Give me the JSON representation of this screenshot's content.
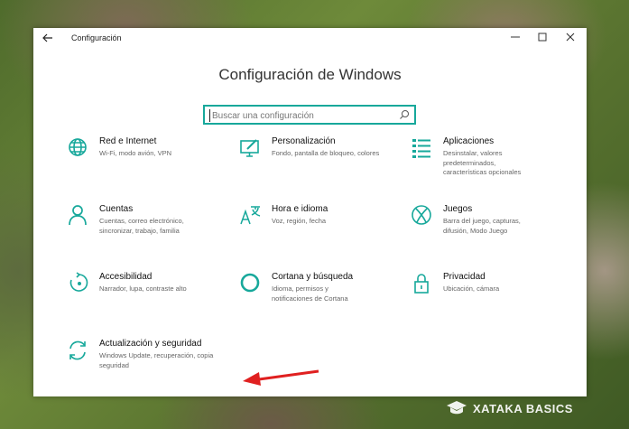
{
  "window": {
    "title": "Configuración",
    "heading": "Configuración de Windows",
    "controls": [
      "minimize-icon",
      "maximize-icon",
      "close-icon"
    ]
  },
  "search": {
    "placeholder": "Buscar una configuración",
    "value": ""
  },
  "tiles": [
    {
      "title": "Red e Internet",
      "desc": "Wi-Fi, modo avión, VPN",
      "icon": "globe-icon"
    },
    {
      "title": "Personalización",
      "desc": "Fondo, pantalla de bloqueo, colores",
      "icon": "personalization-icon"
    },
    {
      "title": "Aplicaciones",
      "desc": "Desinstalar, valores predeterminados, características opcionales",
      "icon": "apps-list-icon"
    },
    {
      "title": "Cuentas",
      "desc": "Cuentas, correo electrónico, sincronizar, trabajo, familia",
      "icon": "person-icon"
    },
    {
      "title": "Hora e idioma",
      "desc": "Voz, región, fecha",
      "icon": "time-language-icon"
    },
    {
      "title": "Juegos",
      "desc": "Barra del juego, capturas, difusión, Modo Juego",
      "icon": "xbox-icon"
    },
    {
      "title": "Accesibilidad",
      "desc": "Narrador, lupa, contraste alto",
      "icon": "accessibility-icon"
    },
    {
      "title": "Cortana y búsqueda",
      "desc": "Idioma, permisos y notificaciones de Cortana",
      "icon": "cortana-icon"
    },
    {
      "title": "Privacidad",
      "desc": "Ubicación, cámara",
      "icon": "lock-icon"
    },
    {
      "title": "Actualización y seguridad",
      "desc": "Windows Update, recuperación, copia seguridad",
      "icon": "update-icon"
    }
  ],
  "watermark": {
    "text": "XATAKA BASICS"
  },
  "colors": {
    "accent": "#17a89b",
    "annotation_arrow": "#e02020"
  }
}
